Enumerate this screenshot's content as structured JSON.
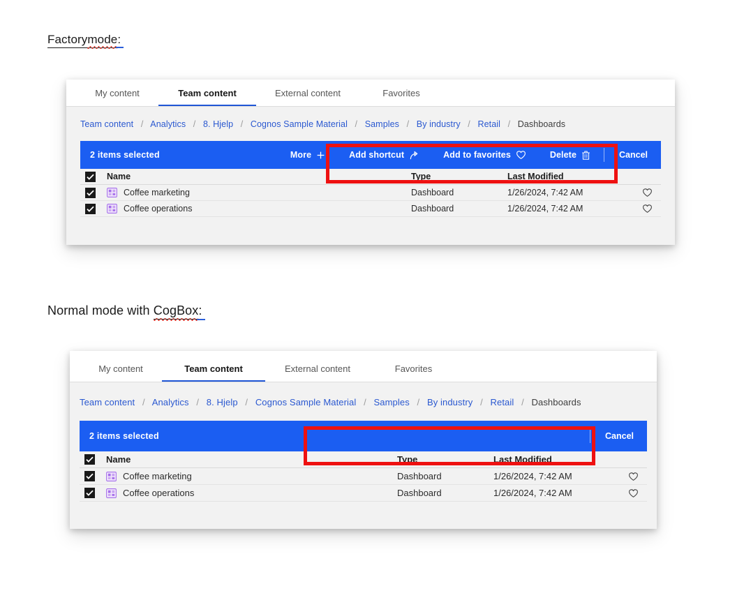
{
  "headings": {
    "factory": {
      "plain": "Factory",
      "spell": "mode",
      "colon": " :",
      "full": "Factorymode :"
    },
    "normal": {
      "plain": "Normal mode with ",
      "spell": "CogBox",
      "colon": " :",
      "full": "Normal mode with CogBox :"
    }
  },
  "colors": {
    "action_bar_blue": "#1b5ef2",
    "tab_accent_blue": "#1f56d6",
    "breadcrumb_link": "#2a58d0",
    "annotation_red": "#ee1111",
    "panel_body_gray": "#f2f2f2",
    "dashboard_icon_purple": "#8a3ffc"
  },
  "panels": [
    {
      "id": "factory",
      "tabs": [
        {
          "label": "My content",
          "active": false
        },
        {
          "label": "Team content",
          "active": true
        },
        {
          "label": "External content",
          "active": false
        },
        {
          "label": "Favorites",
          "active": false
        }
      ],
      "breadcrumb": [
        {
          "label": "Team content",
          "last": false
        },
        {
          "label": "Analytics",
          "last": false
        },
        {
          "label": "8. Hjelp",
          "last": false
        },
        {
          "label": "Cognos Sample Material",
          "last": false
        },
        {
          "label": "Samples",
          "last": false
        },
        {
          "label": "By industry",
          "last": false
        },
        {
          "label": "Retail",
          "last": false
        },
        {
          "label": "Dashboards",
          "last": true
        }
      ],
      "breadcrumb_separator": "/",
      "action_bar": {
        "selection_label": "2 items selected",
        "actions": [
          {
            "label": "More",
            "icon": "plus-icon"
          },
          {
            "label": "Add shortcut",
            "icon": "shortcut-icon"
          },
          {
            "label": "Add to favorites",
            "icon": "heart-icon"
          },
          {
            "label": "Delete",
            "icon": "trash-icon"
          }
        ],
        "cancel_label": "Cancel"
      },
      "table": {
        "columns": [
          "Name",
          "Type",
          "Last Modified"
        ],
        "rows": [
          {
            "name": "Coffee marketing",
            "type": "Dashboard",
            "modified": "1/26/2024, 7:42 AM",
            "checked": true,
            "icon": "dashboard-icon",
            "favorite_icon": "heart-icon"
          },
          {
            "name": "Coffee operations",
            "type": "Dashboard",
            "modified": "1/26/2024, 7:42 AM",
            "checked": true,
            "icon": "dashboard-icon",
            "favorite_icon": "heart-icon"
          }
        ]
      }
    },
    {
      "id": "normal",
      "tabs": [
        {
          "label": "My content",
          "active": false
        },
        {
          "label": "Team content",
          "active": true
        },
        {
          "label": "External content",
          "active": false
        },
        {
          "label": "Favorites",
          "active": false
        }
      ],
      "breadcrumb": [
        {
          "label": "Team content",
          "last": false
        },
        {
          "label": "Analytics",
          "last": false
        },
        {
          "label": "8. Hjelp",
          "last": false
        },
        {
          "label": "Cognos Sample Material",
          "last": false
        },
        {
          "label": "Samples",
          "last": false
        },
        {
          "label": "By industry",
          "last": false
        },
        {
          "label": "Retail",
          "last": false
        },
        {
          "label": "Dashboards",
          "last": true
        }
      ],
      "breadcrumb_separator": "/",
      "action_bar": {
        "selection_label": "2 items selected",
        "actions": [],
        "cancel_label": "Cancel"
      },
      "table": {
        "columns": [
          "Name",
          "Type",
          "Last Modified"
        ],
        "rows": [
          {
            "name": "Coffee marketing",
            "type": "Dashboard",
            "modified": "1/26/2024, 7:42 AM",
            "checked": true,
            "icon": "dashboard-icon",
            "favorite_icon": "heart-icon"
          },
          {
            "name": "Coffee operations",
            "type": "Dashboard",
            "modified": "1/26/2024, 7:42 AM",
            "checked": true,
            "icon": "dashboard-icon",
            "favorite_icon": "heart-icon"
          }
        ]
      }
    }
  ],
  "annotations": [
    {
      "name": "factory-toolbar-highlight",
      "shape": "rectangle",
      "color": "#ee1111"
    },
    {
      "name": "normal-toolbar-highlight",
      "shape": "rectangle",
      "color": "#ee1111"
    }
  ]
}
